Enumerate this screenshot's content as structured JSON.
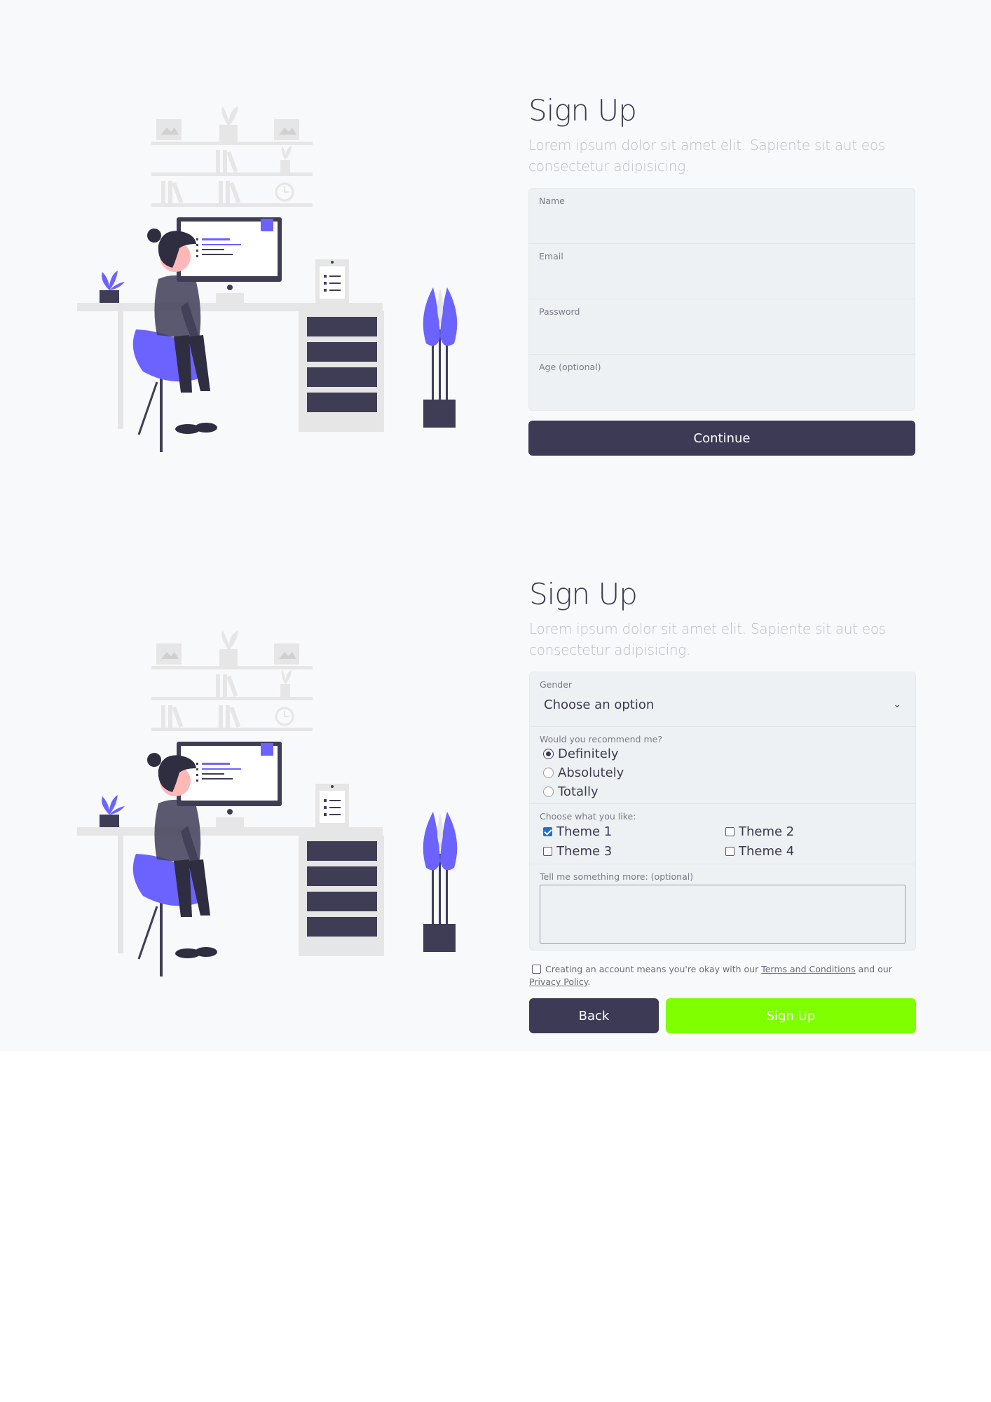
{
  "colors": {
    "dark_button": "#3c3a54",
    "signup_button": "#7fff00",
    "accent_purple": "#6c63ff",
    "background": "#f8f9fb",
    "field_background": "#eef1f3"
  },
  "step1": {
    "title": "Sign Up",
    "subtitle": "Lorem ipsum dolor sit amet elit. Sapiente sit aut eos consectetur adipisicing.",
    "fields": [
      {
        "label": "Name",
        "value": ""
      },
      {
        "label": "Email",
        "value": ""
      },
      {
        "label": "Password",
        "value": ""
      },
      {
        "label": "Age (optional)",
        "value": ""
      }
    ],
    "continue_label": "Continue"
  },
  "step2": {
    "title": "Sign Up",
    "subtitle": "Lorem ipsum dolor sit amet elit. Sapiente sit aut eos consectetur adipisicing.",
    "gender": {
      "label": "Gender",
      "selected": "Choose an option"
    },
    "recommend": {
      "label": "Would you recommend me?",
      "options": [
        "Definitely",
        "Absolutely",
        "Totally"
      ],
      "selected": "Definitely"
    },
    "themes": {
      "label": "Choose what you like:",
      "options": [
        "Theme 1",
        "Theme 2",
        "Theme 3",
        "Theme 4"
      ],
      "checked": [
        "Theme 1"
      ]
    },
    "more": {
      "label": "Tell me something more: (optional)",
      "value": ""
    },
    "terms": {
      "prefix": "Creating an account means you're okay with our",
      "terms_link": "Terms and Conditions",
      "middle": "and our",
      "privacy_link": "Privacy Policy",
      "suffix": ".",
      "checked": false
    },
    "back_label": "Back",
    "signup_label": "Sign Up"
  },
  "illustration": {
    "icon": "person-at-desk-illustration"
  }
}
